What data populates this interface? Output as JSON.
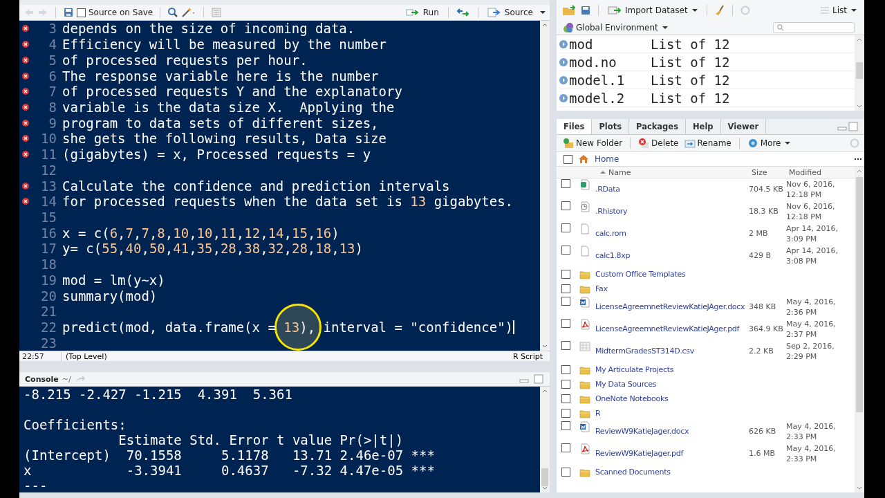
{
  "editor": {
    "toolbar": {
      "source_on_save": {
        "label": "Source on Save",
        "checked": false
      },
      "run": "Run",
      "source": "Source"
    },
    "lines": [
      {
        "num": "3",
        "error": true,
        "text": "depends on the size of incoming data."
      },
      {
        "num": "4",
        "error": true,
        "text": "Efficiency will be measured by the number"
      },
      {
        "num": "5",
        "error": true,
        "text": "of processed requests per hour."
      },
      {
        "num": "6",
        "error": true,
        "text": "The response variable here is the number"
      },
      {
        "num": "7",
        "error": true,
        "text": "of processed requests Y and the explanatory"
      },
      {
        "num": "8",
        "error": true,
        "text": "variable is the data size X.  Applying the"
      },
      {
        "num": "9",
        "error": true,
        "text": "program to data sets of different sizes,"
      },
      {
        "num": "10",
        "error": true,
        "text": "she gets the following results, Data size"
      },
      {
        "num": "11",
        "error": true,
        "text": "(gigabytes) = x, Processed requests = y"
      },
      {
        "num": "12",
        "error": false
      },
      {
        "num": "13",
        "error": true,
        "text": "Calculate the confidence and prediction intervals"
      },
      {
        "num": "14",
        "error": true,
        "text": "for processed requests when the data set is 13 gigabytes."
      },
      {
        "num": "15",
        "error": false
      },
      {
        "num": "16",
        "error": false,
        "text": "x = c(6,7,7,8,10,10,11,12,14,15,16)"
      },
      {
        "num": "17",
        "error": false,
        "text": "y= c(55,40,50,41,35,28,38,32,28,18,13)"
      },
      {
        "num": "18",
        "error": false
      },
      {
        "num": "19",
        "error": false,
        "text": "mod = lm(y~x)"
      },
      {
        "num": "20",
        "error": false,
        "text": "summary(mod)"
      },
      {
        "num": "21",
        "error": false
      },
      {
        "num": "22",
        "error": false,
        "text": "predict(mod, data.frame(x = 13), interval = \"confidence\")"
      },
      {
        "num": "23",
        "error": false
      }
    ],
    "status": {
      "position": "22:57",
      "scope": "(Top Level)",
      "type": "R Script"
    }
  },
  "console": {
    "title": "Console",
    "path": "~/",
    "lines": [
      {
        "kind": "output",
        "text": "-8.215 -2.427 -1.215  4.391  5.361"
      },
      {
        "kind": "blank"
      },
      {
        "kind": "output",
        "text": "Coefficients:"
      },
      {
        "kind": "output",
        "text": "            Estimate Std. Error t value Pr(>|t|)"
      },
      {
        "kind": "output",
        "text": "(Intercept)  70.1558     5.1178   13.71 2.46e-07 ***"
      },
      {
        "kind": "output",
        "text": "x            -3.3941     0.4637   -7.32 4.47e-05 ***"
      },
      {
        "kind": "output",
        "text": "---"
      }
    ]
  },
  "environment": {
    "toolbar": {
      "import": "Import Dataset",
      "view": "List"
    },
    "scope": "Global Environment",
    "rows": [
      {
        "name": "mod",
        "value": "List of 12"
      },
      {
        "name": "mod.no",
        "value": "List of 12"
      },
      {
        "name": "model.1",
        "value": "List of 12"
      },
      {
        "name": "model.2",
        "value": "List of 12"
      }
    ]
  },
  "files": {
    "tabs": [
      {
        "label": "Files",
        "selected": true
      },
      {
        "label": "Plots",
        "selected": false
      },
      {
        "label": "Packages",
        "selected": false
      },
      {
        "label": "Help",
        "selected": false
      },
      {
        "label": "Viewer",
        "selected": false
      }
    ],
    "toolbar": {
      "new_folder": "New Folder",
      "delete": "Delete",
      "rename": "Rename",
      "more": "More"
    },
    "select_all_checked": false,
    "breadcrumb": "Home",
    "columns": [
      "Name",
      "Size",
      "Modified"
    ],
    "rows": [
      {
        "kind": "rdata",
        "name": ".RData",
        "size": "704.5 KB",
        "modified": "Nov 6, 2016, 12:18 PM",
        "checked": false
      },
      {
        "kind": "history",
        "name": ".Rhistory",
        "size": "18.3 KB",
        "modified": "Nov 6, 2016, 12:18 PM",
        "checked": false
      },
      {
        "kind": "file",
        "name": "calc.rom",
        "size": "2 MB",
        "modified": "Apr 14, 2016, 3:09 PM",
        "checked": false
      },
      {
        "kind": "file",
        "name": "calc1.8xp",
        "size": "429 B",
        "modified": "Apr 14, 2016, 3:08 PM",
        "checked": false
      },
      {
        "kind": "folder",
        "name": "Custom Office Templates",
        "checked": false
      },
      {
        "kind": "folder",
        "name": "Fax",
        "checked": false
      },
      {
        "kind": "word",
        "name": "LicenseAgreemnetReviewKatieJAger.docx",
        "size": "348 KB",
        "modified": "May 4, 2016, 2:36 PM",
        "checked": false
      },
      {
        "kind": "pdf",
        "name": "LicenseAgreemnetReviewKatieJAger.pdf",
        "size": "364.9 KB",
        "modified": "May 4, 2016, 2:37 PM",
        "checked": false
      },
      {
        "kind": "csv",
        "name": "MidtermGradesST314D.csv",
        "size": "2.2 KB",
        "modified": "Sep 2, 2016, 2:29 PM",
        "checked": false
      },
      {
        "kind": "folder",
        "name": "My Articulate Projects",
        "checked": false
      },
      {
        "kind": "folder",
        "name": "My Data Sources",
        "checked": false
      },
      {
        "kind": "folder",
        "name": "OneNote Notebooks",
        "checked": false
      },
      {
        "kind": "folder",
        "name": "R",
        "checked": false
      },
      {
        "kind": "word",
        "name": "ReviewW9KatieJager.docx",
        "size": "626 KB",
        "modified": "May 4, 2016, 2:33 PM",
        "checked": false
      },
      {
        "kind": "pdf",
        "name": "ReviewW9KatieJager.pdf",
        "size": "1.6 MB",
        "modified": "May 4, 2016, 2:33 PM",
        "checked": false
      },
      {
        "kind": "folder",
        "name": "Scanned Documents",
        "checked": false
      }
    ]
  }
}
